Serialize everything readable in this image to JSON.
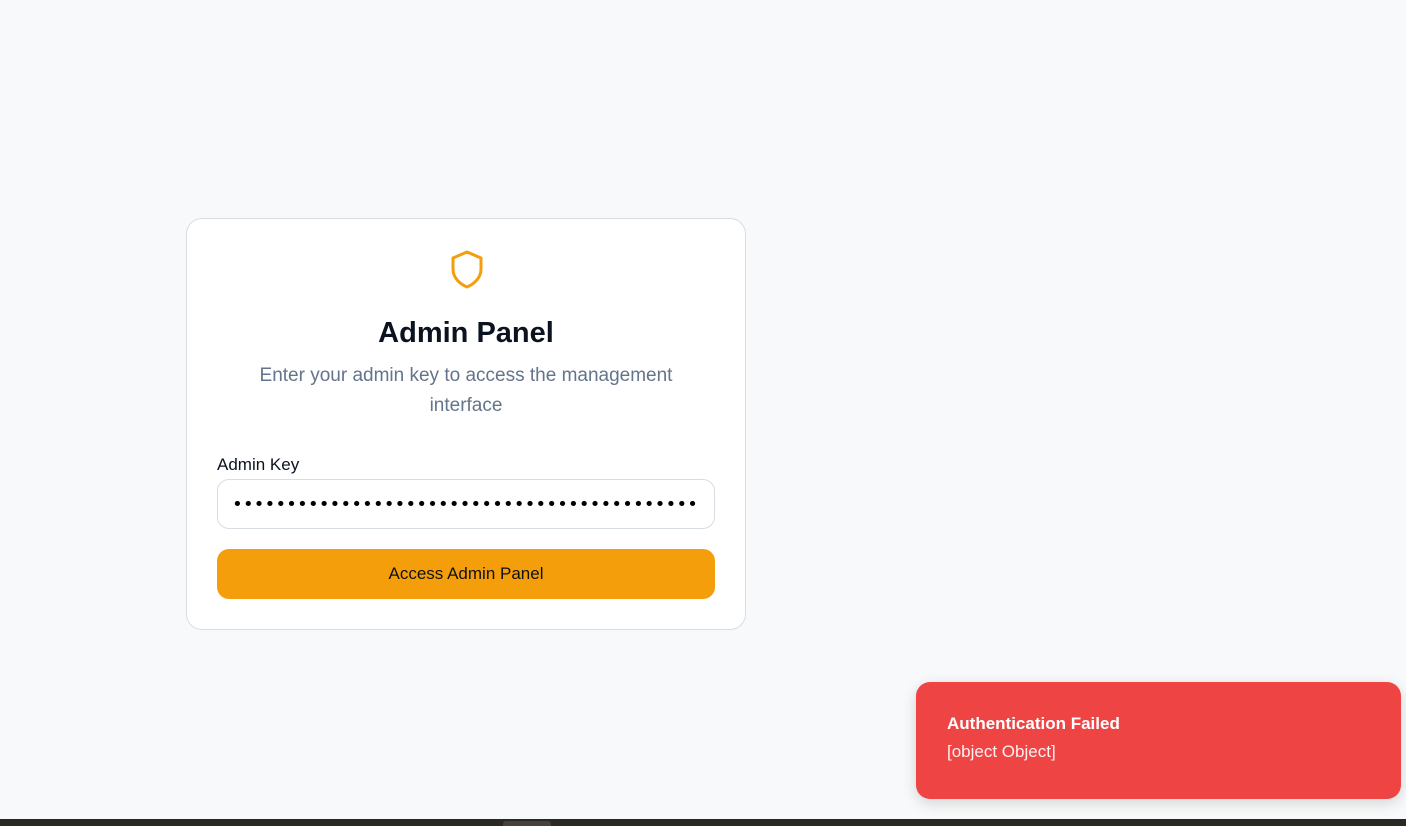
{
  "login": {
    "icon": "shield-icon",
    "title": "Admin Panel",
    "subtitle": "Enter your admin key to access the management interface",
    "key_label": "Admin Key",
    "key_value_masked": "•••••••••••••••••••••••••••••••••••••••••••••••••••••••",
    "submit_label": "Access Admin Panel"
  },
  "toast": {
    "title": "Authentication Failed",
    "message": "[object Object]"
  },
  "colors": {
    "accent": "#f59e0b",
    "error": "#ef4444",
    "background": "#f8f9fa"
  }
}
